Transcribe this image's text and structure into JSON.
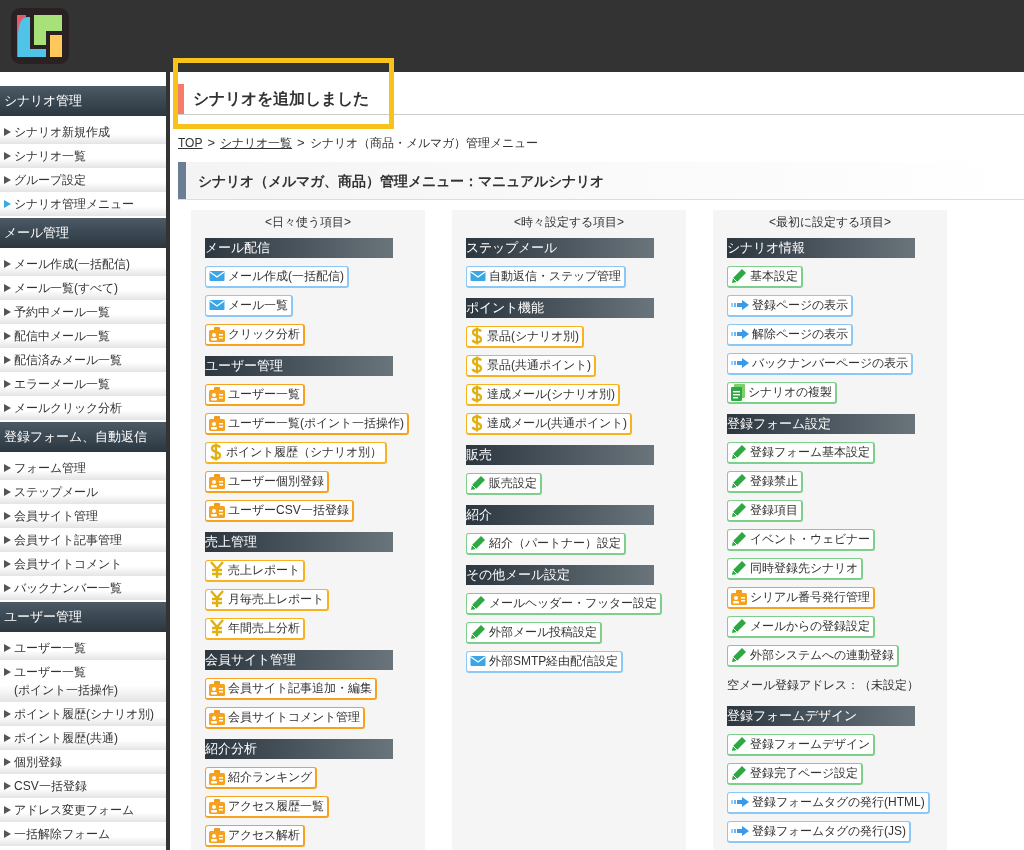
{
  "sidebar": [
    {
      "title": "シナリオ管理",
      "items": [
        {
          "label": "シナリオ新規作成",
          "selected": false
        },
        {
          "label": "シナリオ一覧",
          "selected": false
        },
        {
          "label": "グループ設定",
          "selected": false
        },
        {
          "label": "シナリオ管理メニュー",
          "selected": true
        }
      ]
    },
    {
      "title": "メール管理",
      "items": [
        {
          "label": "メール作成(一括配信)",
          "selected": false
        },
        {
          "label": "メール一覧(すべて)",
          "selected": false
        },
        {
          "label": "予約中メール一覧",
          "selected": false
        },
        {
          "label": "配信中メール一覧",
          "selected": false
        },
        {
          "label": "配信済みメール一覧",
          "selected": false
        },
        {
          "label": "エラーメール一覧",
          "selected": false
        },
        {
          "label": "メールクリック分析",
          "selected": false
        }
      ]
    },
    {
      "title": "登録フォーム、自動返信",
      "items": [
        {
          "label": "フォーム管理",
          "selected": false
        },
        {
          "label": "ステップメール",
          "selected": false
        },
        {
          "label": "会員サイト管理",
          "selected": false
        },
        {
          "label": "会員サイト記事管理",
          "selected": false
        },
        {
          "label": "会員サイトコメント",
          "selected": false
        },
        {
          "label": "バックナンバー一覧",
          "selected": false
        }
      ]
    },
    {
      "title": "ユーザー管理",
      "items": [
        {
          "label": "ユーザー一覧",
          "selected": false
        },
        {
          "label": "ユーザー一覧\n(ポイント一括操作)",
          "selected": false
        },
        {
          "label": "ポイント履歴(シナリオ別)",
          "selected": false
        },
        {
          "label": "ポイント履歴(共通)",
          "selected": false
        },
        {
          "label": "個別登録",
          "selected": false
        },
        {
          "label": "CSV一括登録",
          "selected": false
        },
        {
          "label": "アドレス変更フォーム",
          "selected": false
        },
        {
          "label": "一括解除フォーム",
          "selected": false
        }
      ]
    }
  ],
  "notice": "シナリオを追加しました",
  "breadcrumb": [
    {
      "label": "TOP",
      "link": true
    },
    {
      "label": "シナリオ一覧",
      "link": true
    },
    {
      "label": "シナリオ（商品・メルマガ）管理メニュー",
      "link": false
    }
  ],
  "breadcrumb_separator": ">",
  "heading": "シナリオ（メルマガ、商品）管理メニュー：マニュアルシナリオ",
  "columns": [
    {
      "title": "<日々使う項目>",
      "sections": [
        {
          "title": "メール配信",
          "items": [
            {
              "kind": "mail",
              "label": "メール作成(一括配信)"
            },
            {
              "kind": "mail",
              "label": "メール一覧"
            },
            {
              "kind": "user",
              "label": "クリック分析"
            }
          ]
        },
        {
          "title": "ユーザー管理",
          "items": [
            {
              "kind": "user",
              "label": "ユーザー一覧"
            },
            {
              "kind": "user",
              "label": "ユーザー一覧(ポイント一括操作)"
            },
            {
              "kind": "dollar",
              "label": "ポイント履歴（シナリオ別）"
            },
            {
              "kind": "user",
              "label": "ユーザー個別登録"
            },
            {
              "kind": "user",
              "label": "ユーザーCSV一括登録"
            }
          ]
        },
        {
          "title": "売上管理",
          "items": [
            {
              "kind": "yen",
              "label": "売上レポート"
            },
            {
              "kind": "yen",
              "label": "月毎売上レポート"
            },
            {
              "kind": "yen",
              "label": "年間売上分析"
            }
          ]
        },
        {
          "title": "会員サイト管理",
          "items": [
            {
              "kind": "user",
              "label": "会員サイト記事追加・編集"
            },
            {
              "kind": "user",
              "label": "会員サイトコメント管理"
            }
          ]
        },
        {
          "title": "紹介分析",
          "items": [
            {
              "kind": "user",
              "label": "紹介ランキング"
            },
            {
              "kind": "user",
              "label": "アクセス履歴一覧"
            },
            {
              "kind": "user",
              "label": "アクセス解析"
            }
          ]
        }
      ]
    },
    {
      "title": "<時々設定する項目>",
      "sections": [
        {
          "title": "ステップメール",
          "items": [
            {
              "kind": "mail",
              "label": "自動返信・ステップ管理"
            }
          ]
        },
        {
          "title": "ポイント機能",
          "items": [
            {
              "kind": "dollar",
              "label": "景品(シナリオ別)"
            },
            {
              "kind": "dollar",
              "label": "景品(共通ポイント)"
            },
            {
              "kind": "dollar",
              "label": "達成メール(シナリオ別)"
            },
            {
              "kind": "dollar",
              "label": "達成メール(共通ポイント)"
            }
          ]
        },
        {
          "title": "販売",
          "items": [
            {
              "kind": "pencil",
              "label": "販売設定"
            }
          ]
        },
        {
          "title": "紹介",
          "items": [
            {
              "kind": "pencil",
              "label": "紹介（パートナー）設定"
            }
          ]
        },
        {
          "title": "その他メール設定",
          "items": [
            {
              "kind": "pencil",
              "label": "メールヘッダー・フッター設定"
            },
            {
              "kind": "pencil",
              "label": "外部メール投稿設定"
            },
            {
              "kind": "mail",
              "label": "外部SMTP経由配信設定"
            }
          ]
        }
      ]
    },
    {
      "title": "<最初に設定する項目>",
      "sections": [
        {
          "title": "シナリオ情報",
          "items": [
            {
              "kind": "pencil",
              "label": "基本設定"
            },
            {
              "kind": "arrow",
              "label": "登録ページの表示"
            },
            {
              "kind": "arrow",
              "label": "解除ページの表示"
            },
            {
              "kind": "arrow",
              "label": "バックナンバーページの表示"
            },
            {
              "kind": "copy",
              "label": "シナリオの複製"
            }
          ]
        },
        {
          "title": "登録フォーム設定",
          "items": [
            {
              "kind": "pencil",
              "label": "登録フォーム基本設定"
            },
            {
              "kind": "pencil",
              "label": "登録禁止"
            },
            {
              "kind": "pencil",
              "label": "登録項目"
            },
            {
              "kind": "pencil",
              "label": "イベント・ウェビナー"
            },
            {
              "kind": "pencil",
              "label": "同時登録先シナリオ"
            },
            {
              "kind": "user",
              "label": "シリアル番号発行管理"
            },
            {
              "kind": "pencil",
              "label": "メールからの登録設定"
            },
            {
              "kind": "pencil",
              "label": "外部システムへの連動登録"
            },
            {
              "kind": "text",
              "label": "空メール登録アドレス：（未設定）"
            }
          ]
        },
        {
          "title": "登録フォームデザイン",
          "items": [
            {
              "kind": "pencil",
              "label": "登録フォームデザイン"
            },
            {
              "kind": "pencil",
              "label": "登録完了ページ設定"
            },
            {
              "kind": "arrow",
              "label": "登録フォームタグの発行(HTML)"
            },
            {
              "kind": "arrow",
              "label": "登録フォームタグの発行(JS)"
            }
          ]
        }
      ]
    }
  ]
}
